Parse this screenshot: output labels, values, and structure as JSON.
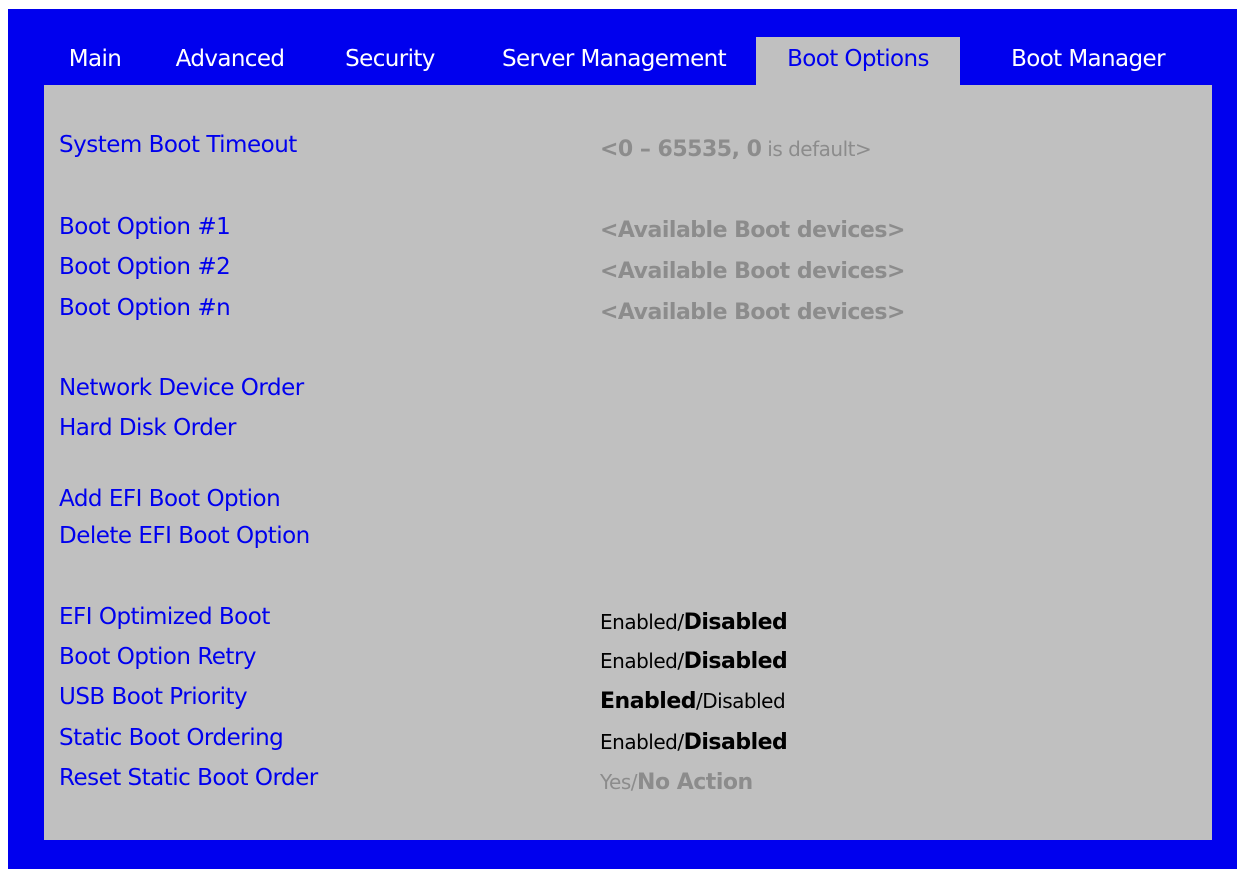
{
  "tabs": {
    "main": "Main",
    "advanced": "Advanced",
    "security": "Security",
    "server_management": "Server Management",
    "boot_options": "Boot Options",
    "boot_manager": "Boot Manager",
    "active": "Boot Options"
  },
  "settings": {
    "system_boot_timeout": {
      "label": "System Boot Timeout",
      "value_range": "<0 – 65535, 0",
      "value_suffix": " is default>"
    },
    "boot_option_1": {
      "label": "Boot Option #1",
      "value": "<Available Boot devices>"
    },
    "boot_option_2": {
      "label": "Boot Option #2",
      "value": "<Available Boot devices>"
    },
    "boot_option_n": {
      "label": "Boot Option #n",
      "value": "<Available Boot devices>"
    },
    "network_device_order": {
      "label": "Network Device Order"
    },
    "hard_disk_order": {
      "label": "Hard Disk Order"
    },
    "add_efi_boot_option": {
      "label": "Add EFI Boot Option"
    },
    "delete_efi_boot_option": {
      "label": "Delete EFI Boot Option"
    },
    "efi_optimized_boot": {
      "label": "EFI Optimized Boot",
      "option_a": "Enabled",
      "separator": "/",
      "option_b": "Disabled",
      "default": "Disabled"
    },
    "boot_option_retry": {
      "label": "Boot Option Retry",
      "option_a": "Enabled",
      "separator": "/",
      "option_b": "Disabled",
      "default": "Disabled"
    },
    "usb_boot_priority": {
      "label": "USB Boot Priority",
      "option_a": "Enabled",
      "separator": "/",
      "option_b": "Disabled",
      "default": "Enabled"
    },
    "static_boot_ordering": {
      "label": "Static Boot Ordering",
      "option_a": "Enabled",
      "separator": "/",
      "option_b": "Disabled",
      "default": "Disabled"
    },
    "reset_static_boot_order": {
      "label": "Reset Static Boot Order",
      "option_a": "Yes",
      "separator": "/",
      "option_b": "No Action",
      "default": "No Action"
    }
  },
  "colors": {
    "frame_blue": "#0000ee",
    "panel_gray": "#c0c0c0",
    "label_blue": "#0000ee",
    "value_gray": "#8c8c8c",
    "value_black": "#000000"
  }
}
